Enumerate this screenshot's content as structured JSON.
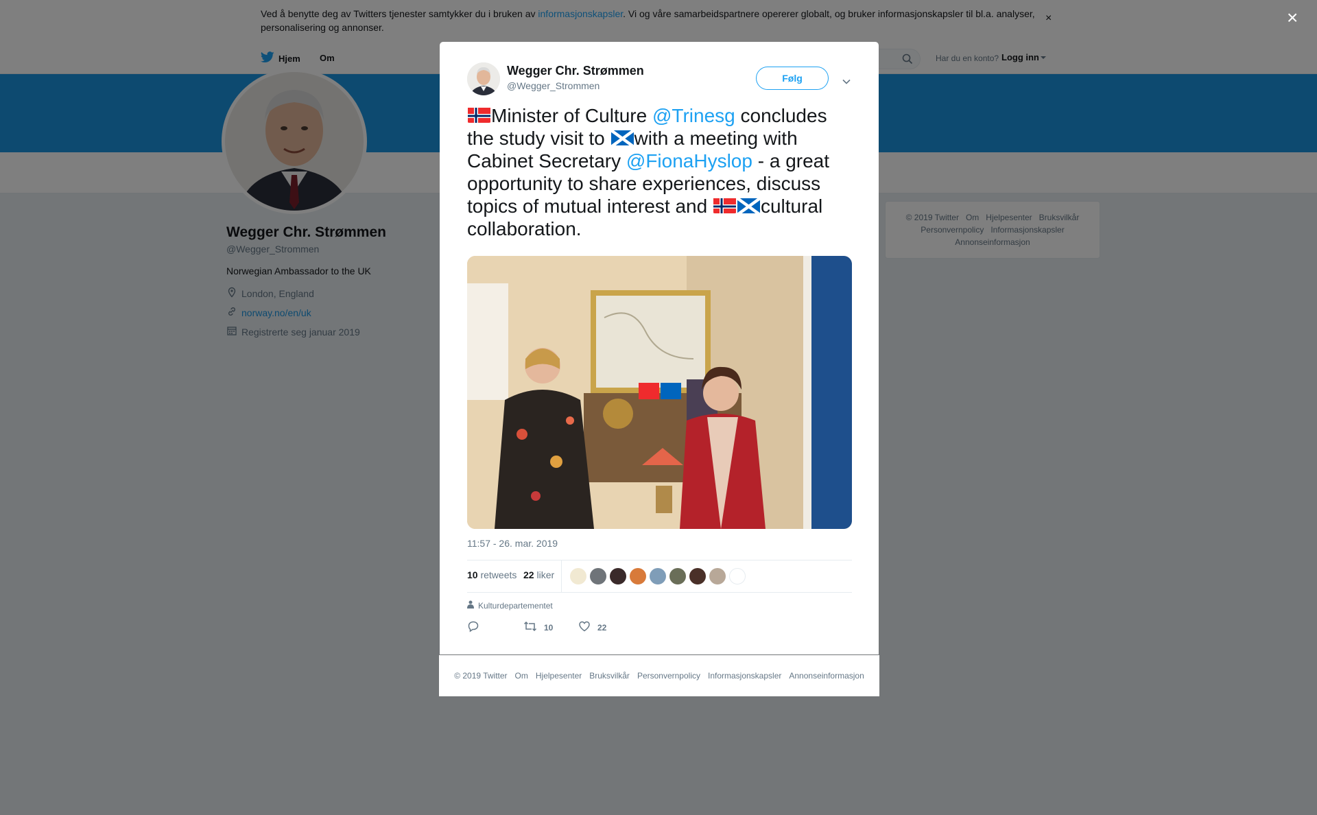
{
  "cookie": {
    "text_before": "Ved å benytte deg av Twitters tjenester samtykker du i bruken av ",
    "link": "informasjonskapsler",
    "text_after": ". Vi og våre samarbeidspartnere opererer globalt, og bruker informasjonskapsler til bl.a. analyser, personalisering og annonser.",
    "close": "×"
  },
  "nav": {
    "home": "Hjem",
    "about": "Om",
    "account_question": "Har du en konto?",
    "login": "Logg inn"
  },
  "profile": {
    "name": "Wegger Chr. Strømmen",
    "handle": "@Wegger_Strommen",
    "bio": "Norwegian Ambassador to the UK",
    "location": "London, England",
    "url": "norway.no/en/uk",
    "joined": "Registrerte seg januar 2019"
  },
  "side_footer": {
    "items": [
      "© 2019 Twitter",
      "Om",
      "Hjelpesenter",
      "Bruksvilkår",
      "Personvernpolicy",
      "Informasjonskapsler",
      "Annonseinformasjon"
    ]
  },
  "overlay_close": "×",
  "tweet": {
    "author_name": "Wegger Chr. Strømmen",
    "author_handle": "@Wegger_Strommen",
    "follow_label": "Følg",
    "text": {
      "t1": "Minister of Culture ",
      "m1": "@Trinesg",
      "t2": " concludes the study visit to ",
      "t3": "with a meeting with Cabinet Secretary ",
      "m2": "@FionaHyslop",
      "t4": " - a great opportunity to share experiences, discuss topics of mutual interest and ",
      "t5": "cultural collaboration."
    },
    "timestamp": "11:57 - 26. mar. 2019",
    "retweets_count": "10",
    "retweets_label": "retweets",
    "likes_count": "22",
    "likes_label": "liker",
    "source": "Kulturdepartementet",
    "action_retweets": "10",
    "action_likes": "22"
  },
  "modal_footer": {
    "items": [
      "© 2019 Twitter",
      "Om",
      "Hjelpesenter",
      "Bruksvilkår",
      "Personvernpolicy",
      "Informasjonskapsler",
      "Annonseinformasjon"
    ]
  },
  "colors": {
    "accent": "#1da1f2",
    "banner": "#1b95e0",
    "overlay": "rgba(0,0,0,0.5)"
  }
}
